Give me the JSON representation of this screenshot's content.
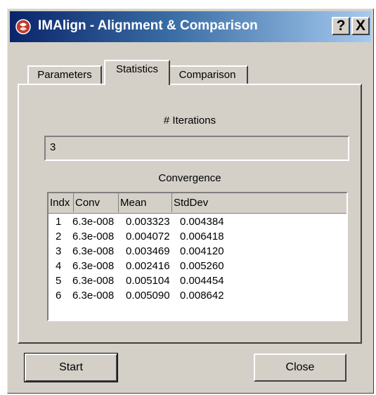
{
  "window": {
    "title": "IMAlign - Alignment & Comparison",
    "help_label": "?",
    "close_label": "X"
  },
  "tabs": [
    {
      "label": "Parameters",
      "active": false
    },
    {
      "label": "Statistics",
      "active": true
    },
    {
      "label": "Comparison",
      "active": false
    }
  ],
  "statistics": {
    "iterations_label": "# Iterations",
    "iterations_value": "3",
    "convergence_label": "Convergence",
    "columns": [
      "Indx",
      "Conv",
      "Mean",
      "StdDev"
    ],
    "rows": [
      [
        "1",
        "6.3e-008",
        "0.003323",
        "0.004384"
      ],
      [
        "2",
        "6.3e-008",
        "0.004072",
        "0.006418"
      ],
      [
        "3",
        "6.3e-008",
        "0.003469",
        "0.004120"
      ],
      [
        "4",
        "6.3e-008",
        "0.002416",
        "0.005260"
      ],
      [
        "5",
        "6.3e-008",
        "0.005104",
        "0.004454"
      ],
      [
        "6",
        "6.3e-008",
        "0.005090",
        "0.008642"
      ]
    ]
  },
  "buttons": {
    "start_label": "Start",
    "close_label": "Close"
  }
}
